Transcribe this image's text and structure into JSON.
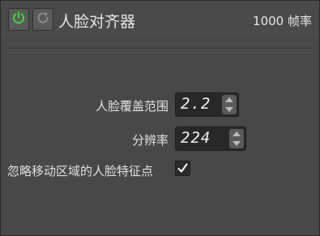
{
  "header": {
    "title": "人脸对齐器",
    "fps_label": "1000 帧率",
    "power_icon": "power-icon",
    "reset_icon": "refresh-icon",
    "power_color": "#3fd63f"
  },
  "fields": {
    "coverage": {
      "label": "人脸覆盖范围",
      "value": "2.2"
    },
    "resolution": {
      "label": "分辨率",
      "value": "224"
    },
    "ignore_moving": {
      "label": "忽略移动区域的人脸特征点",
      "checked": true
    }
  }
}
